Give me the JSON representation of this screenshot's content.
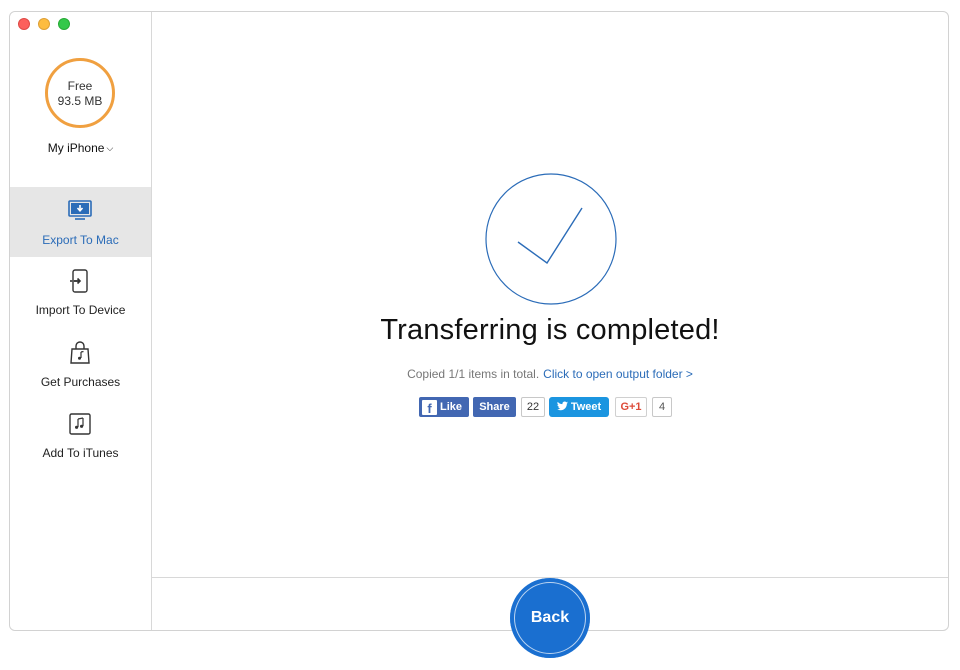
{
  "sidebar": {
    "storage": {
      "line1": "Free",
      "line2": "93.5 MB"
    },
    "device": {
      "label": "My iPhone",
      "chevron": "⌄"
    },
    "items": [
      {
        "label": "Export To Mac",
        "icon": "export-to-mac-icon",
        "active": true
      },
      {
        "label": "Import To Device",
        "icon": "import-to-device-icon",
        "active": false
      },
      {
        "label": "Get Purchases",
        "icon": "purchases-bag-icon",
        "active": false
      },
      {
        "label": "Add To iTunes",
        "icon": "itunes-note-icon",
        "active": false
      }
    ]
  },
  "main": {
    "title": "Transferring is completed!",
    "subtitle_text": "Copied 1/1 items in total.",
    "subtitle_link": "Click to open output folder >",
    "social": {
      "like_label": "Like",
      "share_label": "Share",
      "share_count": "22",
      "tweet_label": "Tweet",
      "gplus_label": "G+1",
      "gplus_count": "4"
    },
    "back_label": "Back"
  },
  "colors": {
    "accent": "#2b6cb8",
    "storage_ring": "#f0a040",
    "facebook": "#4267b2",
    "twitter": "#1b95e0",
    "back_button": "#1a6fd0"
  }
}
